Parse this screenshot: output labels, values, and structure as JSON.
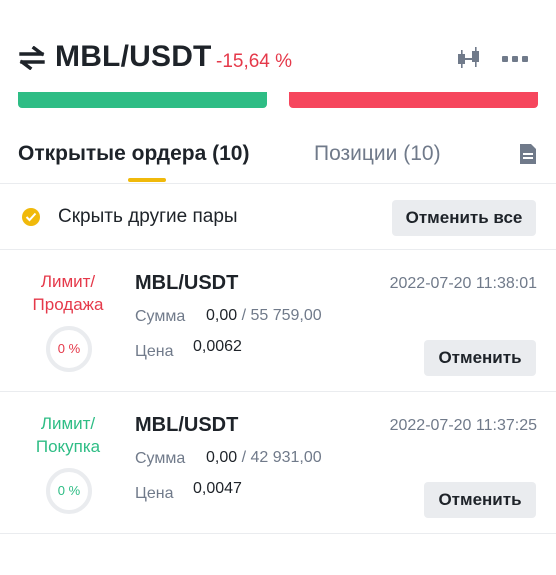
{
  "header": {
    "pair": "MBL/USDT",
    "change": "-15,64 %",
    "icons": {
      "swap": "swap-arrows-icon",
      "chart": "candlestick-icon",
      "more": "more-dots-icon"
    }
  },
  "trade_buttons": {
    "buy_color": "#2ebd85",
    "sell_color": "#f6465d"
  },
  "tabs": [
    {
      "label": "Открытые ордера (10)",
      "active": true
    },
    {
      "label": "Позиции (10)",
      "active": false
    }
  ],
  "filter": {
    "hide_other_pairs": "Скрыть другие пары",
    "checked": true,
    "cancel_all": "Отменить все"
  },
  "orders": [
    {
      "side_line1": "Лимит/",
      "side_line2": "Продажа",
      "side": "sell",
      "progress": "0 %",
      "pair": "MBL/USDT",
      "time": "2022-07-20 11:38:01",
      "amount_label": "Сумма",
      "amount_filled": "0,00",
      "amount_total": "55 759,00",
      "price_label": "Цена",
      "price": "0,0062",
      "cancel": "Отменить"
    },
    {
      "side_line1": "Лимит/",
      "side_line2": "Покупка",
      "side": "buy",
      "progress": "0 %",
      "pair": "MBL/USDT",
      "time": "2022-07-20 11:37:25",
      "amount_label": "Сумма",
      "amount_filled": "0,00",
      "amount_total": "42 931,00",
      "price_label": "Цена",
      "price": "0,0047",
      "cancel": "Отменить"
    }
  ],
  "colors": {
    "accent": "#f0b90b",
    "sell": "#e5394a",
    "buy": "#2ebd85",
    "muted": "#707a8a"
  }
}
